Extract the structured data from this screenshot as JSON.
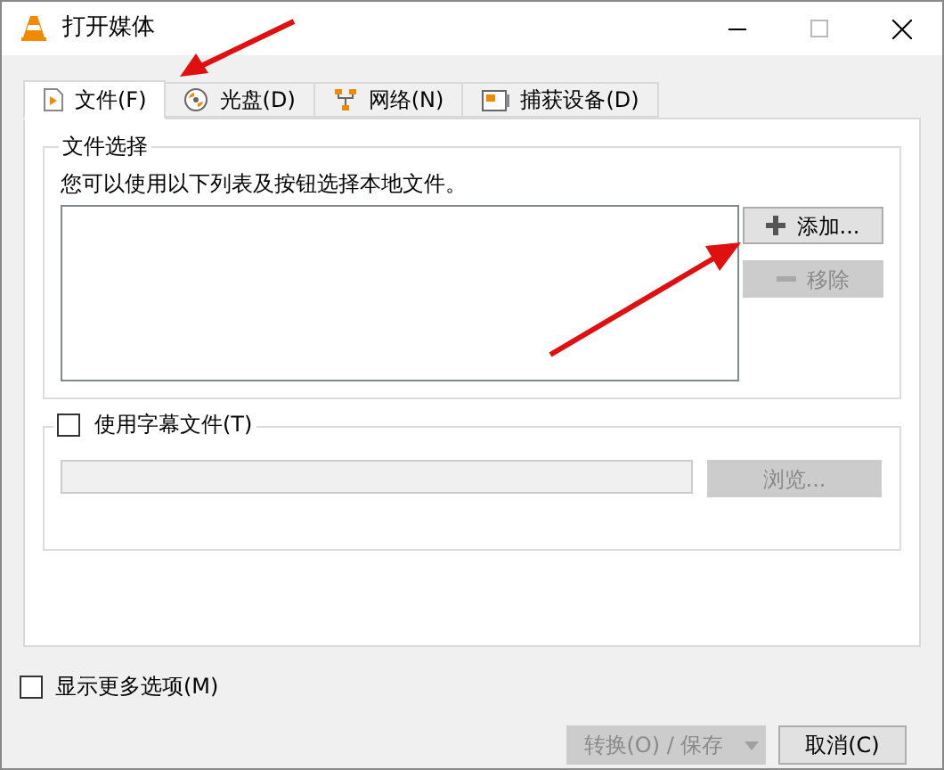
{
  "window": {
    "title": "打开媒体"
  },
  "tabs": [
    {
      "label": "文件(F)",
      "kind": "file",
      "selected": true
    },
    {
      "label": "光盘(D)",
      "kind": "disc",
      "selected": false
    },
    {
      "label": "网络(N)",
      "kind": "network",
      "selected": false
    },
    {
      "label": "捕获设备(D)",
      "kind": "capture",
      "selected": false
    }
  ],
  "file_group": {
    "title": "文件选择",
    "hint": "您可以使用以下列表及按钮选择本地文件。",
    "buttons": [
      {
        "label": "添加...",
        "kind": "add",
        "disabled": false
      },
      {
        "label": "移除",
        "kind": "remove",
        "disabled": true
      }
    ]
  },
  "subtitle": {
    "label": "使用字幕文件(T)",
    "checked": false,
    "browse": {
      "label": "浏览...",
      "disabled": true
    }
  },
  "more_options": {
    "label": "显示更多选项(M)",
    "checked": false
  },
  "footer": {
    "convert": {
      "label": "转换(O) / 保存",
      "disabled": true
    },
    "cancel": {
      "label": "取消(C)"
    }
  }
}
